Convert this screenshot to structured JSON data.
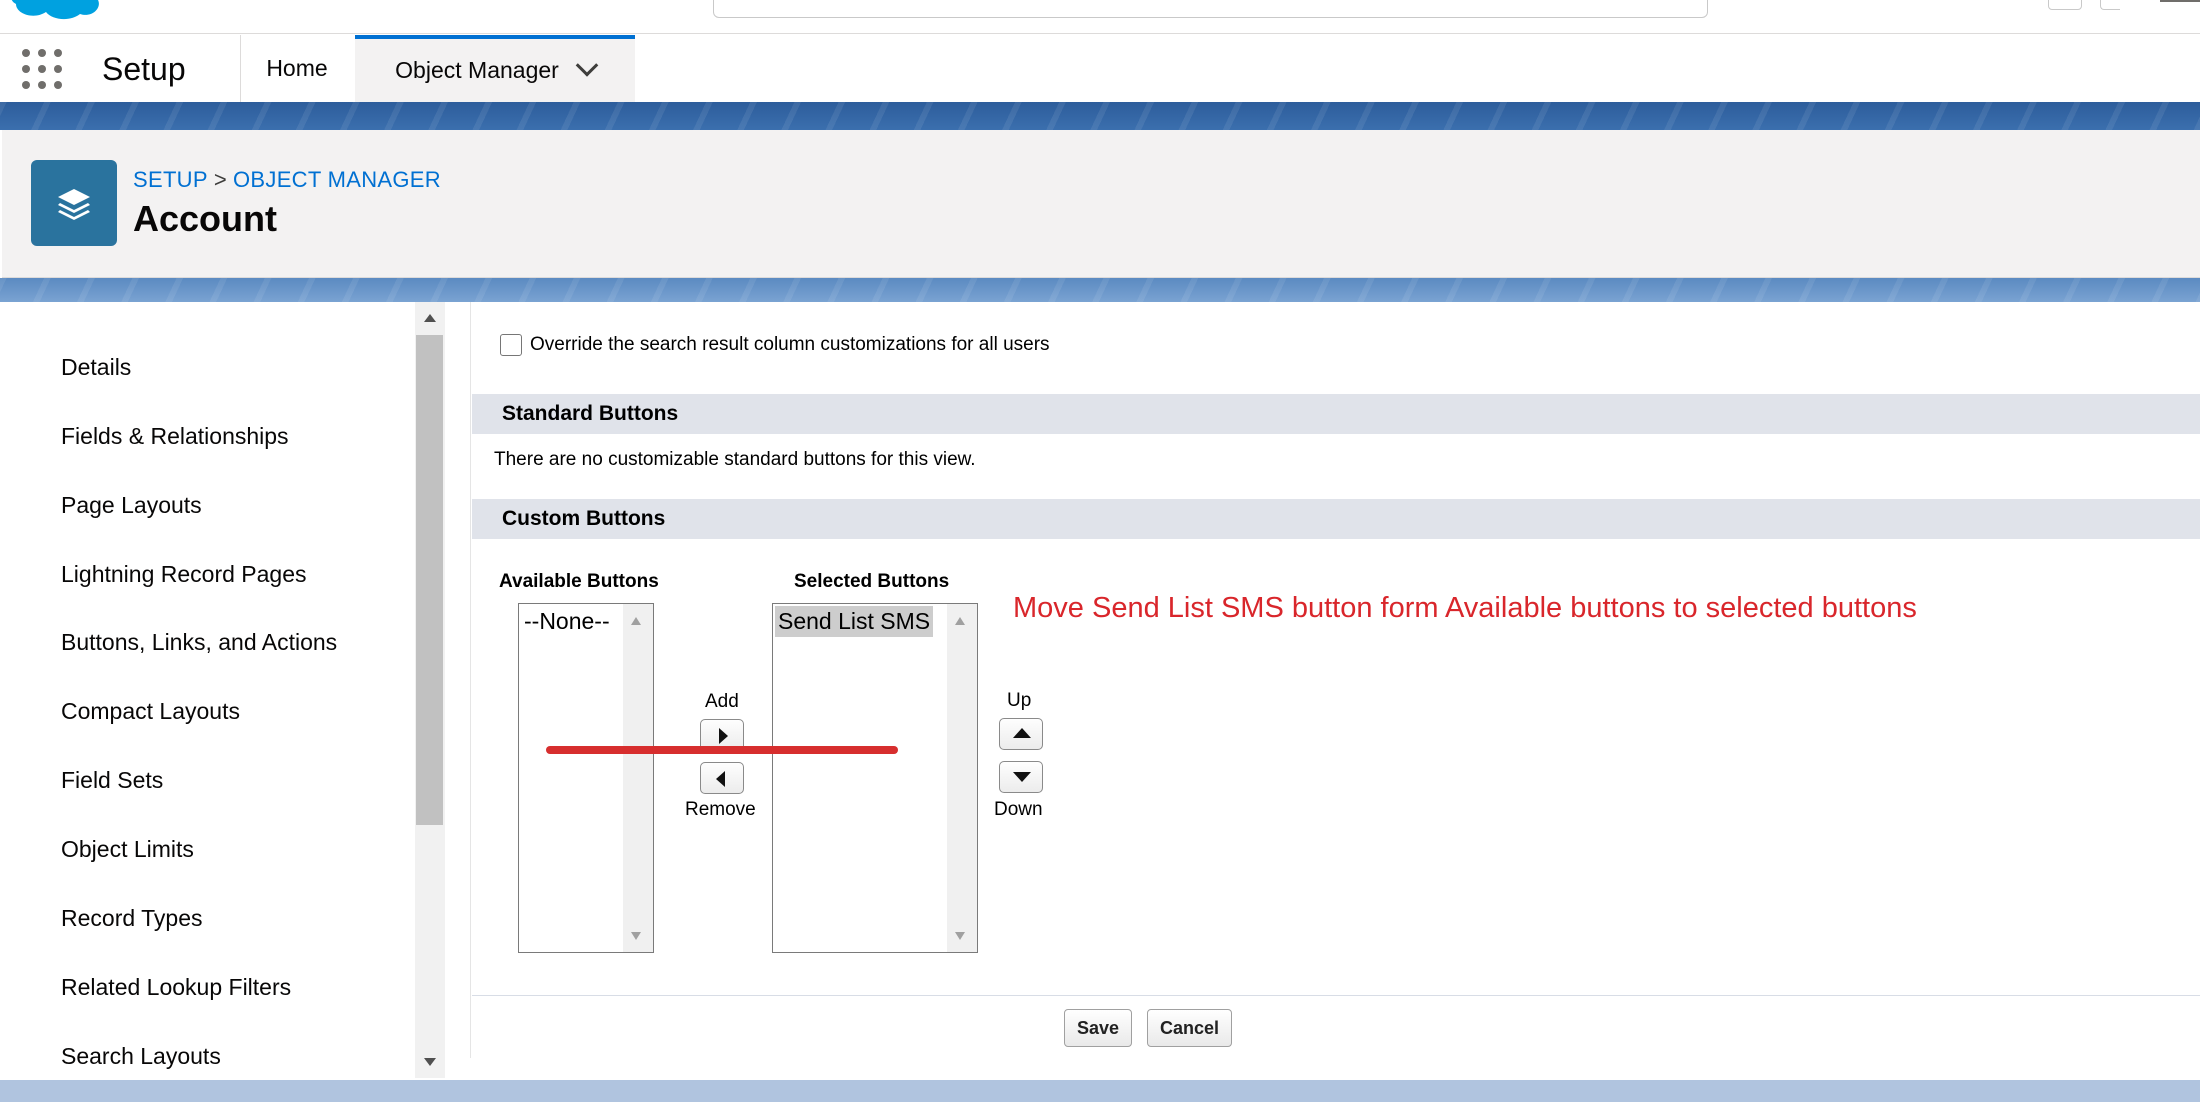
{
  "app": {
    "name": "Setup"
  },
  "nav": {
    "tabs": [
      {
        "label": "Home"
      },
      {
        "label": "Object Manager"
      }
    ]
  },
  "header": {
    "breadcrumb": {
      "setup": "SETUP",
      "separator": ">",
      "object_manager": "OBJECT MANAGER"
    },
    "title": "Account",
    "icon": "layers-icon"
  },
  "sidebar": {
    "items": [
      {
        "label": "Details"
      },
      {
        "label": "Fields & Relationships"
      },
      {
        "label": "Page Layouts"
      },
      {
        "label": "Lightning Record Pages"
      },
      {
        "label": "Buttons, Links, and Actions"
      },
      {
        "label": "Compact Layouts"
      },
      {
        "label": "Field Sets"
      },
      {
        "label": "Object Limits"
      },
      {
        "label": "Record Types"
      },
      {
        "label": "Related Lookup Filters"
      },
      {
        "label": "Search Layouts"
      }
    ]
  },
  "main": {
    "override_label": "Override the search result column customizations for all users",
    "standard_buttons": {
      "title": "Standard Buttons",
      "note": "There are no customizable standard buttons for this view."
    },
    "custom_buttons": {
      "title": "Custom Buttons",
      "available_label": "Available Buttons",
      "selected_label": "Selected Buttons",
      "available_options": [
        "--None--"
      ],
      "selected_options": [
        "Send List SMS"
      ],
      "add_label": "Add",
      "remove_label": "Remove",
      "up_label": "Up",
      "down_label": "Down"
    },
    "annotation": "Move Send List SMS button form Available buttons to selected buttons",
    "save_label": "Save",
    "cancel_label": "Cancel"
  },
  "colors": {
    "accent": "#0070d2",
    "annotation": "#d9262b",
    "object_icon": "#2a739e"
  }
}
